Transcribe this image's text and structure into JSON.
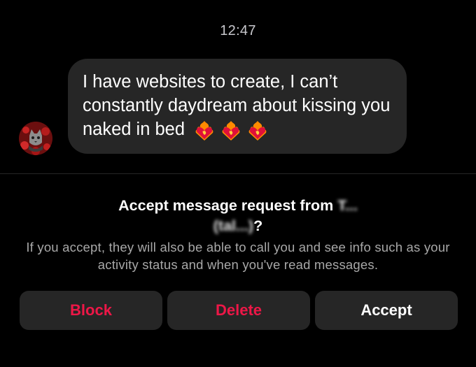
{
  "chat": {
    "timestamp": "12:47",
    "message": {
      "text": "I have websites to create, I can’t constantly daydream about kissing you naked in bed",
      "emoji": [
        "heart-on-fire",
        "heart-on-fire",
        "heart-on-fire"
      ]
    },
    "avatar_icon": "profile-avatar"
  },
  "request": {
    "title_prefix": "Accept message request from ",
    "title_blurred_1": "T...",
    "title_blurred_2": "(tal...)",
    "title_suffix": "?",
    "description": "If you accept, they will also be able to call you and see info such as your activity status and when you've read messages."
  },
  "actions": {
    "block_label": "Block",
    "delete_label": "Delete",
    "accept_label": "Accept"
  },
  "colors": {
    "background": "#000000",
    "bubble": "#262626",
    "button": "#262626",
    "danger": "#ed1747",
    "muted_text": "#a8a8a8",
    "heart_red": "#e0103a",
    "fire_orange": "#ff8a00"
  }
}
